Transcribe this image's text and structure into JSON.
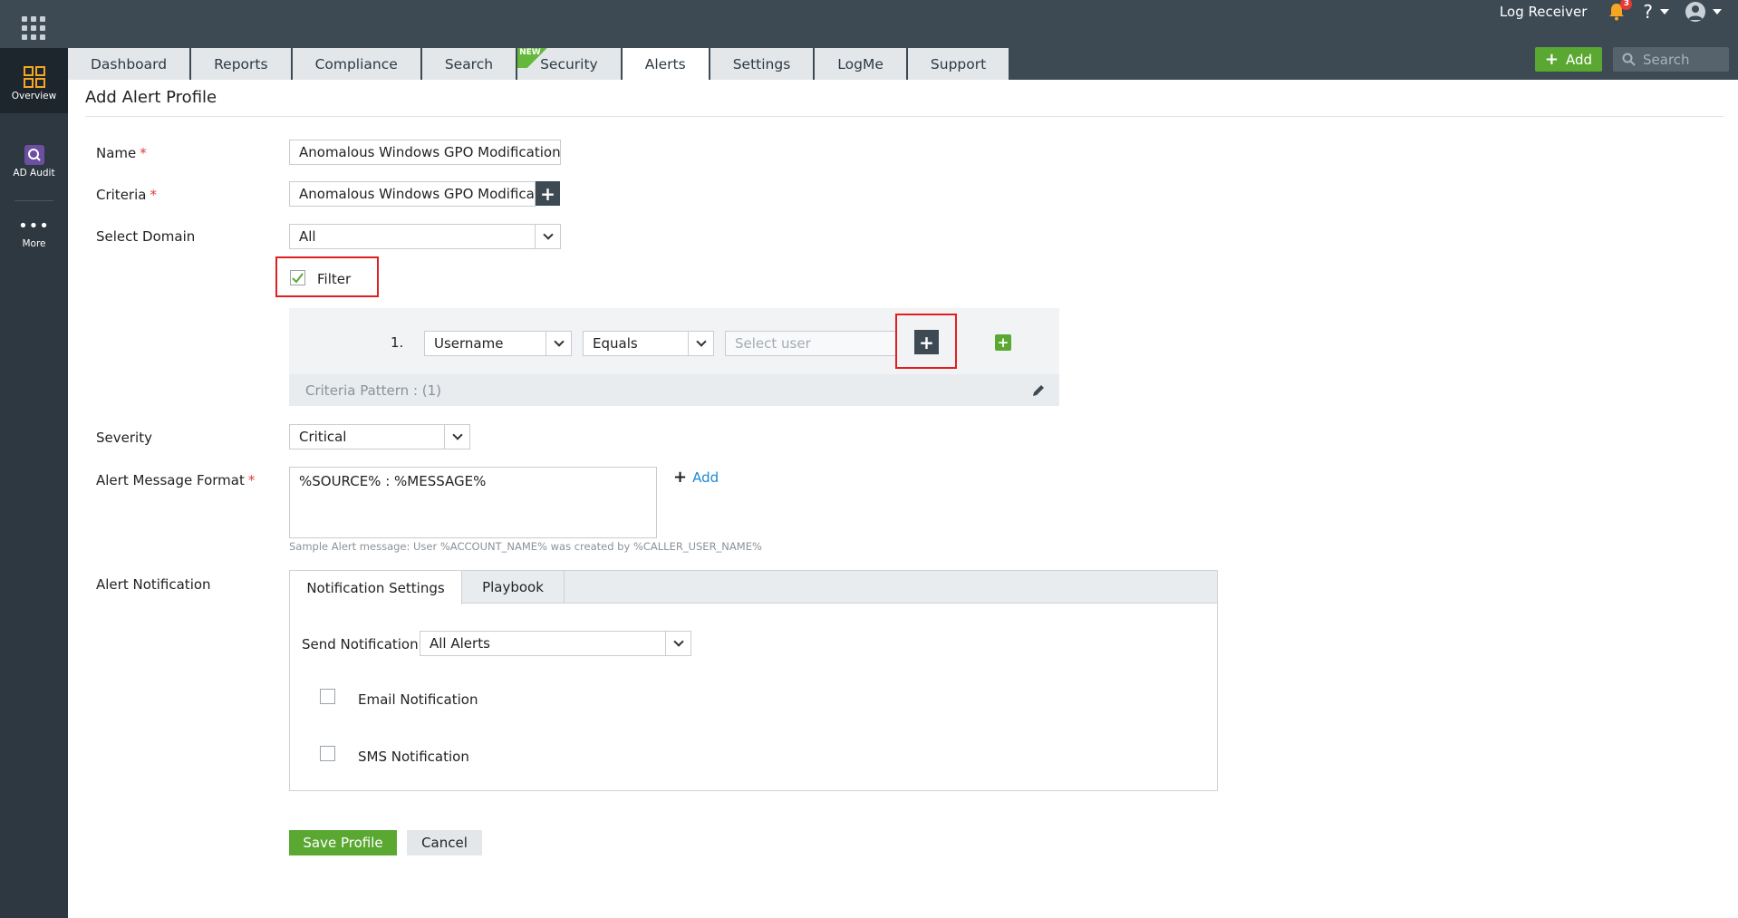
{
  "top": {
    "log_receiver": "Log Receiver",
    "notification_count": "3",
    "help": "?"
  },
  "tabs": [
    {
      "label": "Dashboard"
    },
    {
      "label": "Reports"
    },
    {
      "label": "Compliance"
    },
    {
      "label": "Search"
    },
    {
      "label": "Security",
      "badge": "NEW"
    },
    {
      "label": "Alerts"
    },
    {
      "label": "Settings"
    },
    {
      "label": "LogMe"
    },
    {
      "label": "Support"
    }
  ],
  "actions": {
    "add_label": "Add",
    "search_placeholder": "Search"
  },
  "sidebar": {
    "items": [
      {
        "label": "Overview"
      },
      {
        "label": "AD Audit"
      },
      {
        "label": "More"
      }
    ]
  },
  "page": {
    "title": "Add Alert Profile"
  },
  "form": {
    "name_label": "Name",
    "name_value": "Anomalous Windows GPO Modification",
    "criteria_label": "Criteria",
    "criteria_value": "Anomalous Windows GPO Modification",
    "domain_label": "Select Domain",
    "domain_value": "All",
    "filter_label": "Filter",
    "filter_row": {
      "index": "1.",
      "field": "Username",
      "operator": "Equals",
      "value_placeholder": "Select user"
    },
    "criteria_pattern": "Criteria Pattern : (1)",
    "severity_label": "Severity",
    "severity_value": "Critical",
    "message_label": "Alert Message Format",
    "message_value": "%SOURCE% : %MESSAGE%",
    "message_add": "Add",
    "sample_message": "Sample Alert message: User %ACCOUNT_NAME% was created by %CALLER_USER_NAME%",
    "notification_label": "Alert Notification",
    "notification_tabs": [
      "Notification Settings",
      "Playbook"
    ],
    "send_notification_label": "Send Notification",
    "send_notification_value": "All Alerts",
    "email_label": "Email Notification",
    "sms_label": "SMS Notification",
    "save_label": "Save Profile",
    "cancel_label": "Cancel"
  },
  "colors": {
    "topbar": "#3d4a54",
    "sidebar": "#2e3841",
    "accent_green": "#5aa832",
    "highlight_red": "#e02020",
    "link_blue": "#1e88d6"
  }
}
